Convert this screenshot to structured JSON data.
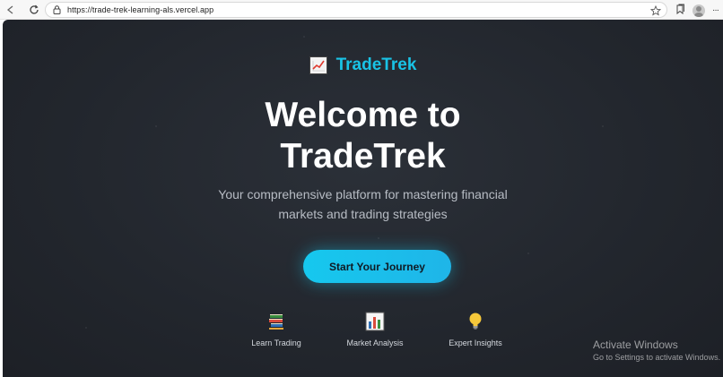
{
  "browser": {
    "url": "https://trade-trek-learning-als.vercel.app"
  },
  "brand": {
    "name": "TradeTrek",
    "icon": "chart-increasing-icon"
  },
  "hero": {
    "title_line1": "Welcome to",
    "title_line2": "TradeTrek",
    "subtitle_line1": "Your comprehensive platform for mastering financial",
    "subtitle_line2": "markets and trading strategies",
    "cta_label": "Start Your Journey"
  },
  "features": [
    {
      "label": "Learn Trading",
      "icon": "books-icon"
    },
    {
      "label": "Market Analysis",
      "icon": "bar-chart-icon"
    },
    {
      "label": "Expert Insights",
      "icon": "light-bulb-icon"
    }
  ],
  "watermark": {
    "title": "Activate Windows",
    "subtitle": "Go to Settings to activate Windows."
  },
  "colors": {
    "accent": "#19c3e6",
    "background": "#23272e",
    "cta": "#16c8ee"
  }
}
